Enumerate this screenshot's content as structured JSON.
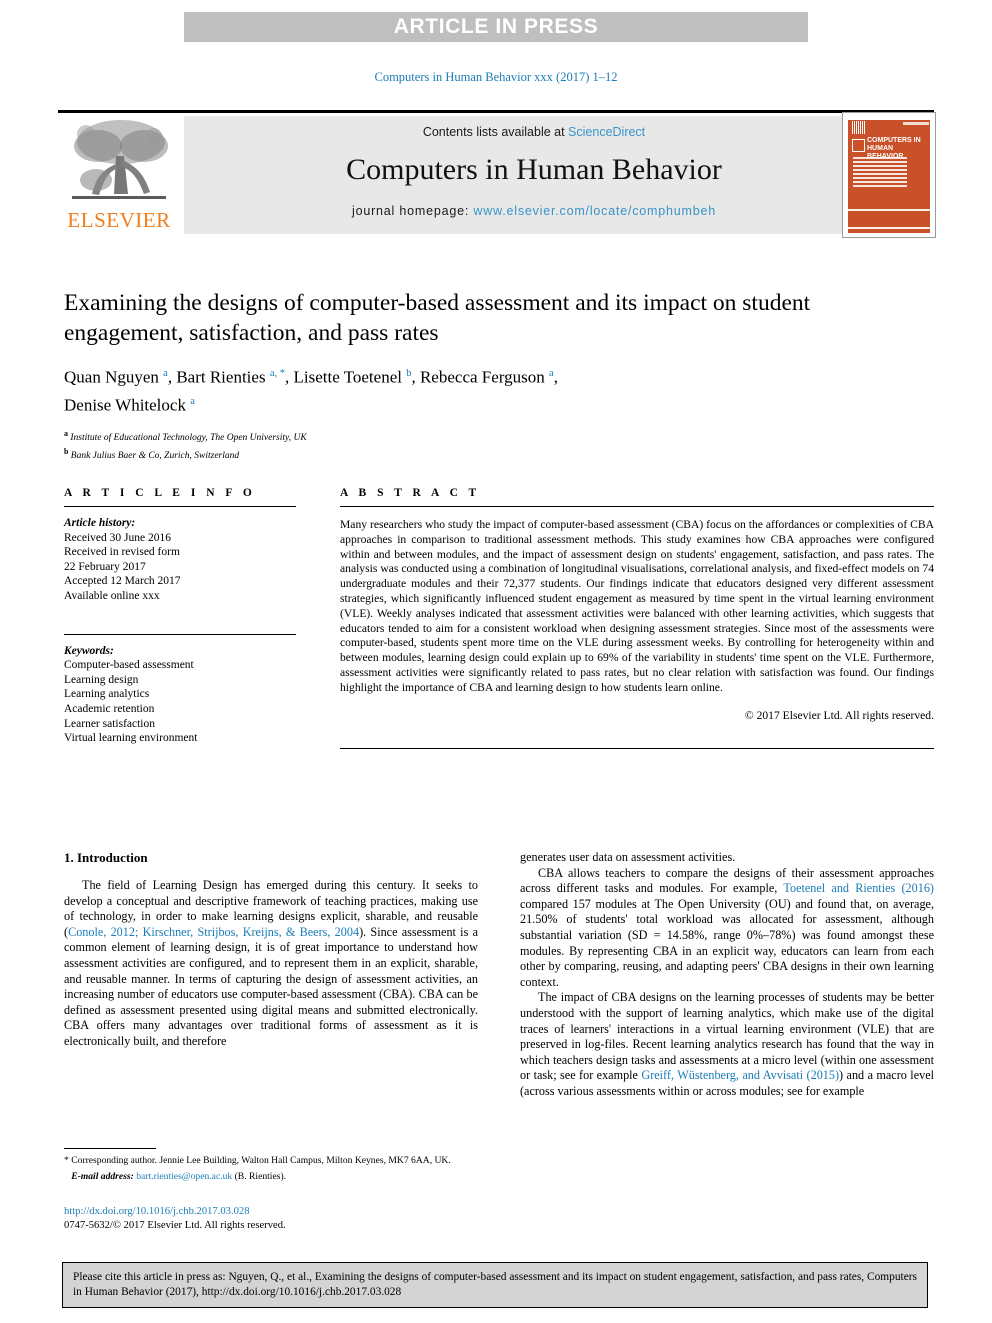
{
  "banner": {
    "text": "ARTICLE IN PRESS"
  },
  "running_head": {
    "text": "Computers in Human Behavior xxx (2017) 1–12"
  },
  "masthead": {
    "publisher": "ELSEVIER",
    "contents_prefix": "Contents lists available at ",
    "contents_link": "ScienceDirect",
    "journal_title": "Computers in Human Behavior",
    "homepage_prefix": "journal homepage: ",
    "homepage_link": "www.elsevier.com/locate/comphumbeh",
    "cover_title": "COMPUTERS IN HUMAN BEHAVIOR",
    "cover_color": "#c9512a",
    "elsevier_orange": "#ef7d1a",
    "link_blue": "#3a93c8"
  },
  "article": {
    "title": "Examining the designs of computer-based assessment and its impact on student engagement, satisfaction, and pass rates",
    "authors_line1": "Quan Nguyen a, Bart Rienties a, *, Lisette Toetenel b, Rebecca Ferguson a,",
    "authors_line2": "Denise Whitelock a",
    "affiliation_a": "Institute of Educational Technology, The Open University, UK",
    "affiliation_b": "Bank Julius Baer & Co, Zurich, Switzerland"
  },
  "info": {
    "heading": "A R T I C L E   I N F O",
    "history_label": "Article history:",
    "history_lines": [
      "Received 30 June 2016",
      "Received in revised form",
      "22 February 2017",
      "Accepted 12 March 2017",
      "Available online xxx"
    ],
    "keywords_label": "Keywords:",
    "keywords": [
      "Computer-based assessment",
      "Learning design",
      "Learning analytics",
      "Academic retention",
      "Learner satisfaction",
      "Virtual learning environment"
    ]
  },
  "abstract": {
    "heading": "A B S T R A C T",
    "text": "Many researchers who study the impact of computer-based assessment (CBA) focus on the affordances or complexities of CBA approaches in comparison to traditional assessment methods. This study examines how CBA approaches were configured within and between modules, and the impact of assessment design on students' engagement, satisfaction, and pass rates. The analysis was conducted using a combination of longitudinal visualisations, correlational analysis, and fixed-effect models on 74 undergraduate modules and their 72,377 students. Our findings indicate that educators designed very different assessment strategies, which significantly influenced student engagement as measured by time spent in the virtual learning environment (VLE). Weekly analyses indicated that assessment activities were balanced with other learning activities, which suggests that educators tended to aim for a consistent workload when designing assessment strategies. Since most of the assessments were computer-based, students spent more time on the VLE during assessment weeks. By controlling for heterogeneity within and between modules, learning design could explain up to 69% of the variability in students' time spent on the VLE. Furthermore, assessment activities were significantly related to pass rates, but no clear relation with satisfaction was found. Our findings highlight the importance of CBA and learning design to how students learn online.",
    "copyright": "© 2017 Elsevier Ltd. All rights reserved."
  },
  "body": {
    "section_number_title": "1. Introduction",
    "left_para_1_a": "The field of Learning Design has emerged during this century. It seeks to develop a conceptual and descriptive framework of teaching practices, making use of technology, in order to make learning designs explicit, sharable, and reusable (",
    "left_para_1_ref1": "Conole, 2012; Kirschner, Strijbos, Kreijns, & Beers, 2004",
    "left_para_1_b": "). Since assessment is a common element of learning design, it is of great importance to understand how assessment activities are configured, and to represent them in an explicit, sharable, and reusable manner. In terms of capturing the design of assessment activities, an increasing number of educators use computer-based assessment (CBA). CBA can be defined as assessment presented using digital means and submitted electronically. CBA offers many advantages over traditional forms of assessment as it is electronically built, and therefore",
    "right_para_0": "generates user data on assessment activities.",
    "right_para_1_a": "CBA allows teachers to compare the designs of their assessment approaches across different tasks and modules. For example, ",
    "right_para_1_ref": "Toetenel and Rienties (2016)",
    "right_para_1_b": " compared 157 modules at The Open University (OU) and found that, on average, 21.50% of students' total workload was allocated for assessment, although substantial variation (SD = 14.58%, range 0%–78%) was found amongst these modules. By representing CBA in an explicit way, educators can learn from each other by comparing, reusing, and adapting peers' CBA designs in their own learning context.",
    "right_para_2_a": "The impact of CBA designs on the learning processes of students may be better understood with the support of learning analytics, which make use of the digital traces of learners' interactions in a virtual learning environment (VLE) that are preserved in log-files. Recent learning analytics research has found that the way in which teachers design tasks and assessments at a micro level (within one assessment or task; see for example ",
    "right_para_2_ref": "Greiff, Wüstenberg, and Avvisati (2015)",
    "right_para_2_b": ") and a macro level (across various assessments within or across modules; see for example"
  },
  "footnote": {
    "star": "*",
    "text": " Corresponding author. Jennie Lee Building, Walton Hall Campus, Milton Keynes, MK7 6AA, UK.",
    "email_label": "E-mail address:",
    "email": "bart.rienties@open.ac.uk",
    "email_suffix": "(B. Rienties)."
  },
  "doi": {
    "url": "http://dx.doi.org/10.1016/j.chb.2017.03.028",
    "issn_line": "0747-5632/© 2017 Elsevier Ltd. All rights reserved."
  },
  "cite_box": {
    "text": "Please cite this article in press as: Nguyen, Q., et al., Examining the designs of computer-based assessment and its impact on student engagement, satisfaction, and pass rates, Computers in Human Behavior (2017), http://dx.doi.org/10.1016/j.chb.2017.03.028"
  }
}
